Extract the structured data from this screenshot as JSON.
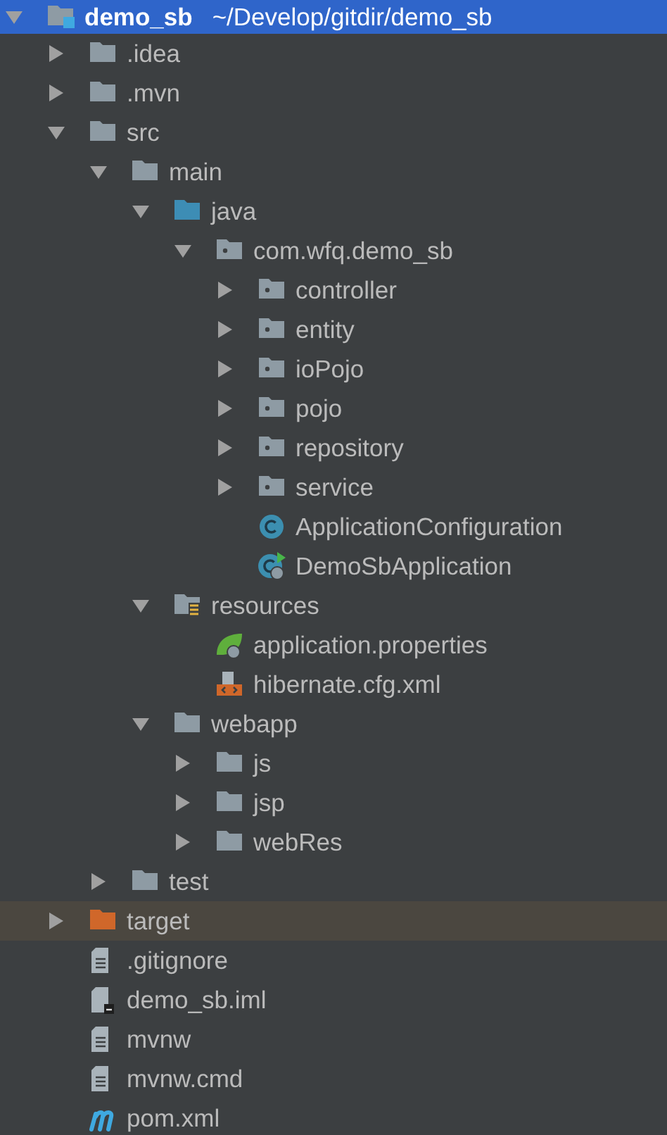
{
  "tree": [
    {
      "kind": "module",
      "label": "demo_sb",
      "path": "~/Develop/gitdir/demo_sb",
      "expanded": true,
      "selected": true,
      "highlighted": false,
      "children": [
        {
          "kind": "folder",
          "label": ".idea",
          "expanded": false,
          "selected": false,
          "highlighted": false
        },
        {
          "kind": "folder",
          "label": ".mvn",
          "expanded": false,
          "selected": false,
          "highlighted": false
        },
        {
          "kind": "folder",
          "label": "src",
          "expanded": true,
          "selected": false,
          "highlighted": false,
          "children": [
            {
              "kind": "folder",
              "label": "main",
              "expanded": true,
              "selected": false,
              "highlighted": false,
              "children": [
                {
                  "kind": "source-folder",
                  "label": "java",
                  "expanded": true,
                  "selected": false,
                  "highlighted": false,
                  "children": [
                    {
                      "kind": "package",
                      "label": "com.wfq.demo_sb",
                      "expanded": true,
                      "selected": false,
                      "highlighted": false,
                      "children": [
                        {
                          "kind": "package",
                          "label": "controller",
                          "expanded": false,
                          "selected": false,
                          "highlighted": false
                        },
                        {
                          "kind": "package",
                          "label": "entity",
                          "expanded": false,
                          "selected": false,
                          "highlighted": false
                        },
                        {
                          "kind": "package",
                          "label": "ioPojo",
                          "expanded": false,
                          "selected": false,
                          "highlighted": false
                        },
                        {
                          "kind": "package",
                          "label": "pojo",
                          "expanded": false,
                          "selected": false,
                          "highlighted": false
                        },
                        {
                          "kind": "package",
                          "label": "repository",
                          "expanded": false,
                          "selected": false,
                          "highlighted": false
                        },
                        {
                          "kind": "package",
                          "label": "service",
                          "expanded": false,
                          "selected": false,
                          "highlighted": false
                        },
                        {
                          "kind": "class",
                          "label": "ApplicationConfiguration",
                          "selected": false,
                          "highlighted": false
                        },
                        {
                          "kind": "boot-class",
                          "label": "DemoSbApplication",
                          "selected": false,
                          "highlighted": false
                        }
                      ]
                    }
                  ]
                },
                {
                  "kind": "resource-folder",
                  "label": "resources",
                  "expanded": true,
                  "selected": false,
                  "highlighted": false,
                  "children": [
                    {
                      "kind": "properties",
                      "label": "application.properties",
                      "selected": false,
                      "highlighted": false
                    },
                    {
                      "kind": "xml",
                      "label": "hibernate.cfg.xml",
                      "selected": false,
                      "highlighted": false
                    }
                  ]
                },
                {
                  "kind": "folder",
                  "label": "webapp",
                  "expanded": true,
                  "selected": false,
                  "highlighted": false,
                  "children": [
                    {
                      "kind": "folder",
                      "label": "js",
                      "expanded": false,
                      "selected": false,
                      "highlighted": false
                    },
                    {
                      "kind": "folder",
                      "label": "jsp",
                      "expanded": false,
                      "selected": false,
                      "highlighted": false
                    },
                    {
                      "kind": "folder",
                      "label": "webRes",
                      "expanded": false,
                      "selected": false,
                      "highlighted": false
                    }
                  ]
                }
              ]
            },
            {
              "kind": "folder",
              "label": "test",
              "expanded": false,
              "selected": false,
              "highlighted": false
            }
          ]
        },
        {
          "kind": "excluded-folder",
          "label": "target",
          "expanded": false,
          "selected": false,
          "highlighted": true
        },
        {
          "kind": "text-file",
          "label": ".gitignore",
          "selected": false,
          "highlighted": false
        },
        {
          "kind": "iml",
          "label": "demo_sb.iml",
          "selected": false,
          "highlighted": false
        },
        {
          "kind": "text-file",
          "label": "mvnw",
          "selected": false,
          "highlighted": false
        },
        {
          "kind": "text-file",
          "label": "mvnw.cmd",
          "selected": false,
          "highlighted": false
        },
        {
          "kind": "maven",
          "label": "pom.xml",
          "selected": false,
          "highlighted": false
        }
      ]
    }
  ]
}
